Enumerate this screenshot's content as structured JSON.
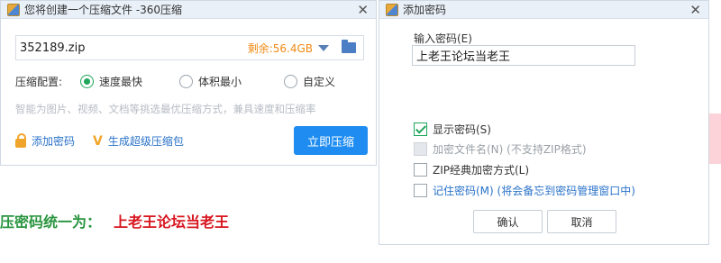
{
  "compress_window": {
    "title": "您将创建一个压缩文件 -360压缩",
    "file_name": "352189.zip",
    "space_left": "剩余:56.4GB",
    "config_label": "压缩配置:",
    "options": [
      "速度最快",
      "体积最小",
      "自定义"
    ],
    "selected_option": "速度最快",
    "hint": "智能为图片、视频、文档等挑选最优压缩方式，兼具速度和压缩率",
    "add_password": "添加密码",
    "super_package": "生成超级压缩包",
    "compress_now": "立即压缩"
  },
  "note": {
    "prefix": "压密码统一为：",
    "password": "上老王论坛当老王"
  },
  "password_dialog": {
    "title": "添加密码",
    "input_label": "输入密码(E)",
    "input_value": "上老王论坛当老王",
    "show_password": "显示密码(S)",
    "encrypt_filename": "加密文件名(N) (不支持ZIP格式)",
    "zip_classic": "ZIP经典加密方式(L)",
    "remember_password": "记住密码(M) (将会备忘到密码管理窗口中)",
    "ok": "确认",
    "cancel": "取消"
  },
  "colors": {
    "accent_blue": "#1e8cf0",
    "space_orange": "#f08a14",
    "radio_green": "#1fa65b",
    "note_green": "#29943f",
    "note_red": "#d8151f"
  }
}
